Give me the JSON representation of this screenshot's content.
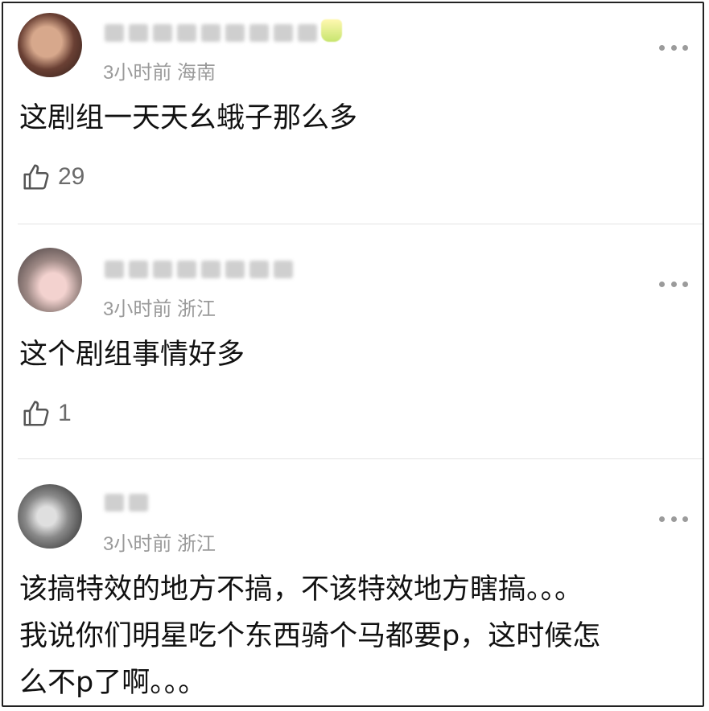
{
  "comments": [
    {
      "time": "3小时前",
      "location": "海南",
      "text": "这剧组一天天幺蛾子那么多",
      "likes": "29"
    },
    {
      "time": "3小时前",
      "location": "浙江",
      "text": "这个剧组事情好多",
      "likes": "1"
    },
    {
      "time": "3小时前",
      "location": "浙江",
      "text": "该搞特效的地方不搞，不该特效地方瞎搞。。。\n我说你们明星吃个东西骑个马都要p，这时候怎\n么不p了啊。。。"
    }
  ],
  "icons": {
    "like": "thumbs-up-icon",
    "more": "more-dots-icon"
  }
}
